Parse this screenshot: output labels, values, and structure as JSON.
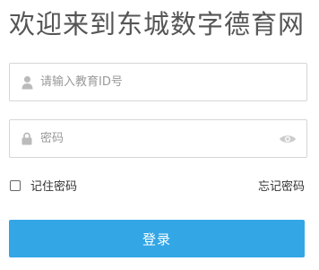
{
  "title": "欢迎来到东城数字德育网",
  "form": {
    "id_field": {
      "placeholder": "请输入教育ID号",
      "value": "",
      "icon": "user-icon"
    },
    "password_field": {
      "placeholder": "密码",
      "value": "",
      "icon": "lock-icon",
      "toggle_icon": "eye-icon"
    },
    "remember_label": "记住密码",
    "remember_checked": false,
    "forgot_label": "忘记密码",
    "login_label": "登录"
  },
  "colors": {
    "primary": "#33a6e6",
    "border": "#d6d6d6",
    "icon": "#bbbbbb",
    "title": "#555555"
  }
}
